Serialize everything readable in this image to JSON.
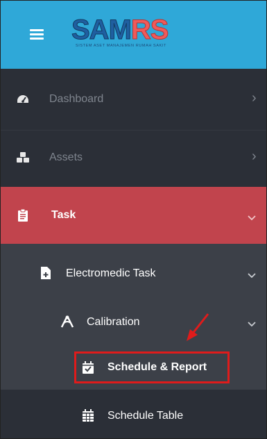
{
  "header": {
    "logo_main": "SAM",
    "logo_accent": "RS",
    "logo_subtitle": "SISTEM ASET MANAJEMEN RUMAH SAKIT",
    "background": "#2fa8d8"
  },
  "sidebar": {
    "items": [
      {
        "label": "Dashboard",
        "icon": "speedometer-icon",
        "chevron": "›"
      },
      {
        "label": "Assets",
        "icon": "cubes-icon",
        "chevron": "›"
      },
      {
        "label": "Task",
        "icon": "clipboard-icon",
        "chevron": "⌄",
        "active": true,
        "active_color": "#c1444d"
      }
    ],
    "task_children": [
      {
        "label": "Electromedic Task",
        "icon": "file-plus-icon",
        "chevron": "⌄"
      }
    ],
    "electromedic_children": [
      {
        "label": "Calibration",
        "icon": "calibration-icon",
        "chevron": "⌄"
      }
    ],
    "calibration_children": [
      {
        "label": "Schedule & Report",
        "icon": "calendar-check-icon",
        "highlighted": true
      },
      {
        "label": "Schedule Table",
        "icon": "calendar-grid-icon"
      }
    ]
  },
  "annotation": {
    "highlight_color": "#e01b1b"
  }
}
